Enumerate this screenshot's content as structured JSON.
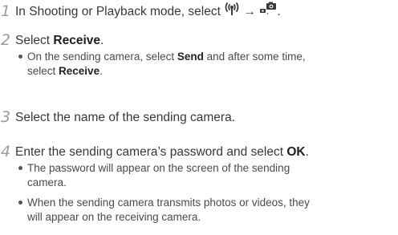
{
  "steps": [
    {
      "number": "1",
      "text_before": "In Shooting or Playback mode, select ",
      "icon_1": "wifi-antenna-icon",
      "arrow": "→",
      "icon_2": "camera-link-icon",
      "text_after": "."
    },
    {
      "number": "2",
      "text_before": "Select ",
      "bold": "Receive",
      "text_after": ".",
      "bullets": [
        {
          "line1_before": "On the sending camera, select ",
          "line1_bold": "Send",
          "line1_after": " and after some time,",
          "line2_before": "select ",
          "line2_bold": "Receive",
          "line2_after": "."
        }
      ]
    },
    {
      "number": "3",
      "text": "Select the name of the sending camera."
    },
    {
      "number": "4",
      "text_before": "Enter the sending camera’s password and select ",
      "bold": "OK",
      "text_after": ".",
      "bullets": [
        {
          "line1": "The password will appear on the screen of the sending",
          "line2": "camera."
        },
        {
          "line1": "When the sending camera transmits photos or videos, they",
          "line2": "will appear on the receiving camera."
        }
      ]
    }
  ]
}
